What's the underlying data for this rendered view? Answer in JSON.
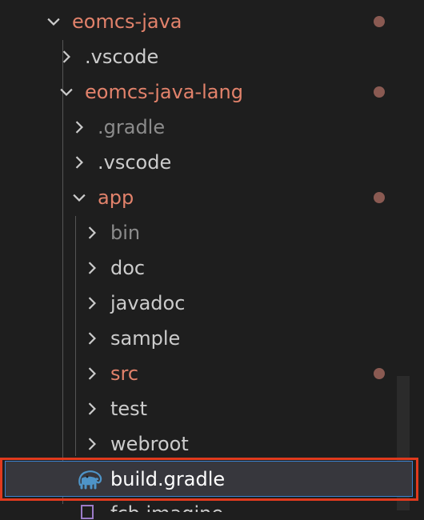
{
  "explorer": {
    "items": [
      {
        "label": "eomcs-java",
        "state": "open",
        "status": "modified"
      },
      {
        "label": ".vscode",
        "state": "closed",
        "status": "normal"
      },
      {
        "label": "eomcs-java-lang",
        "state": "open",
        "status": "modified"
      },
      {
        "label": ".gradle",
        "state": "closed",
        "status": "ignored"
      },
      {
        "label": ".vscode",
        "state": "closed",
        "status": "normal"
      },
      {
        "label": "app",
        "state": "open",
        "status": "modified"
      },
      {
        "label": "bin",
        "state": "closed",
        "status": "ignored"
      },
      {
        "label": "doc",
        "state": "closed",
        "status": "normal"
      },
      {
        "label": "javadoc",
        "state": "closed",
        "status": "normal"
      },
      {
        "label": "sample",
        "state": "closed",
        "status": "normal"
      },
      {
        "label": "src",
        "state": "closed",
        "status": "modified"
      },
      {
        "label": "test",
        "state": "closed",
        "status": "normal"
      },
      {
        "label": "webroot",
        "state": "closed",
        "status": "normal"
      },
      {
        "label": "build.gradle",
        "state": "file",
        "status": "selected",
        "icon": "gradle-elephant-icon"
      },
      {
        "label": "fcb.imagine",
        "state": "file",
        "status": "normal",
        "icon": "file-icon"
      }
    ],
    "colors": {
      "background": "#1e1e1e",
      "modified": "#e2826b",
      "ignored": "#8c8c8c",
      "normal": "#cccccc",
      "selection_outline": "#e03a1e",
      "selection_focus": "#3a82d0",
      "modified_dot": "#8a5a52"
    }
  }
}
